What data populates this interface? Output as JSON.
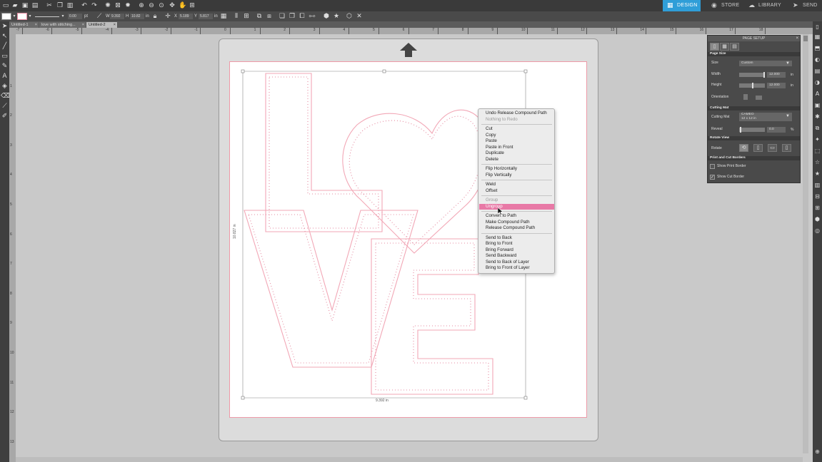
{
  "nav": {
    "tabs": [
      {
        "label": "DESIGN",
        "icon": "design-grid-icon"
      },
      {
        "label": "STORE",
        "icon": "store-icon"
      },
      {
        "label": "LIBRARY",
        "icon": "cloud-library-icon"
      },
      {
        "label": "SEND",
        "icon": "send-icon"
      }
    ]
  },
  "propbar": {
    "stroke_width": "0.00",
    "stroke_unit": "pt",
    "w_label": "W",
    "w_value": "9.392",
    "h_label": "H",
    "h_value": "10.82",
    "h_unit": "in",
    "x_label": "X",
    "x_value": "5.189",
    "y_label": "Y",
    "y_value": "5.817",
    "y_unit": "in"
  },
  "doc_tabs": [
    {
      "label": "Untitled-1",
      "active": false
    },
    {
      "label": "love with stitching...",
      "active": false
    },
    {
      "label": "Untitled-2",
      "active": true
    }
  ],
  "ruler": {
    "top_labels": [
      "-7",
      "-6",
      "-5",
      "-4",
      "-3",
      "-2",
      "-1",
      "0",
      "1",
      "2",
      "3",
      "4",
      "5",
      "6",
      "7",
      "8",
      "9",
      "10",
      "11",
      "12",
      "13",
      "14",
      "15",
      "16",
      "17",
      "18"
    ],
    "left_labels": [
      "1",
      "2",
      "3",
      "4",
      "5",
      "6",
      "7",
      "8",
      "9",
      "10",
      "11",
      "12",
      "13",
      "14"
    ]
  },
  "canvas": {
    "width_label": "9.392 in",
    "height_label": "10.827 in",
    "stroke_color": "#f2a7b6",
    "stitch_color": "#e58aa0"
  },
  "context_menu": {
    "groups": [
      [
        {
          "label": "Undo Release Compound Path",
          "disabled": false
        },
        {
          "label": "Nothing to Redo",
          "disabled": true
        }
      ],
      [
        {
          "label": "Cut",
          "disabled": false
        },
        {
          "label": "Copy",
          "disabled": false
        },
        {
          "label": "Paste",
          "disabled": false
        },
        {
          "label": "Paste in Front",
          "disabled": false
        },
        {
          "label": "Duplicate",
          "disabled": false
        },
        {
          "label": "Delete",
          "disabled": false
        }
      ],
      [
        {
          "label": "Flip Horizontally",
          "disabled": false
        },
        {
          "label": "Flip Vertically",
          "disabled": false
        }
      ],
      [
        {
          "label": "Weld",
          "disabled": false
        },
        {
          "label": "Offset",
          "disabled": false
        }
      ],
      [
        {
          "label": "Group",
          "disabled": true
        },
        {
          "label": "Ungroup",
          "disabled": false,
          "highlighted": true
        }
      ],
      [
        {
          "label": "Convert to Path",
          "disabled": false
        },
        {
          "label": "Make Compound Path",
          "disabled": false
        },
        {
          "label": "Release Compound Path",
          "disabled": false
        }
      ],
      [
        {
          "label": "Send to Back",
          "disabled": false
        },
        {
          "label": "Bring to Front",
          "disabled": false
        },
        {
          "label": "Bring Forward",
          "disabled": false
        },
        {
          "label": "Send Backward",
          "disabled": false
        },
        {
          "label": "Send to Back of Layer",
          "disabled": false
        },
        {
          "label": "Bring to Front of Layer",
          "disabled": false
        }
      ]
    ],
    "highlight_color": "#e879a6"
  },
  "page_setup": {
    "title": "PAGE SETUP",
    "page_size_header": "Page Size",
    "size_label": "Size",
    "size_value": "Custom",
    "width_label": "Width",
    "width_value": "12.000",
    "height_label": "Height",
    "height_value": "12.000",
    "unit": "in",
    "orientation_label": "Orientation",
    "cutting_mat_header": "Cutting Mat",
    "cutting_mat_label": "Cutting Mat",
    "cutting_mat_value_line1": "CAMEO",
    "cutting_mat_value_line2": "12 x 12 in",
    "reveal_label": "Reveal",
    "reveal_value": "0.0",
    "reveal_unit": "%",
    "rotate_view_header": "Rotate View",
    "rotate_label": "Rotate",
    "print_cut_header": "Print and Cut Borders",
    "show_print_border": "Show Print Border",
    "show_print_border_checked": false,
    "show_cut_border": "Show Cut Border",
    "show_cut_border_checked": true
  }
}
